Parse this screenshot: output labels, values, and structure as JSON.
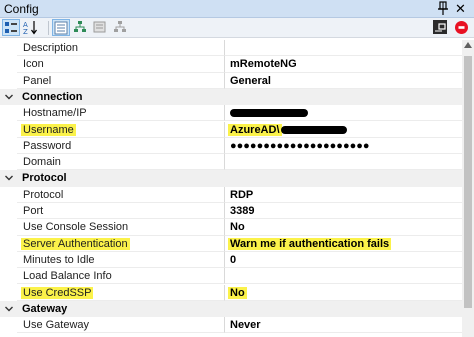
{
  "window": {
    "title": "Config"
  },
  "toolbar": {
    "buttons": [
      {
        "name": "categorized-button",
        "icon": "categorized-icon",
        "active": true
      },
      {
        "name": "alphabetical-button",
        "icon": "sort-az-icon",
        "active": false
      },
      {
        "name": "properties-button",
        "icon": "properties-icon",
        "active": true
      },
      {
        "name": "inheritance-button",
        "icon": "inheritance-icon",
        "active": false
      },
      {
        "name": "default-properties-button",
        "icon": "default-properties-icon",
        "active": false
      },
      {
        "name": "default-inheritance-button",
        "icon": "default-inheritance-icon",
        "active": false
      }
    ],
    "right_icons": [
      "host-status-icon",
      "red-stop-icon"
    ]
  },
  "colors": {
    "highlight": "#fbf24a",
    "titlebar": "#cfe0f3",
    "category_bg": "#f0f0f0",
    "stop_red": "#e81123"
  },
  "rows": [
    {
      "type": "prop",
      "name": "Description",
      "value": ""
    },
    {
      "type": "prop",
      "name": "Icon",
      "value": "mRemoteNG"
    },
    {
      "type": "prop",
      "name": "Panel",
      "value": "General"
    },
    {
      "type": "cat",
      "name": "Connection"
    },
    {
      "type": "prop",
      "name": "Hostname/IP",
      "value": "",
      "redact": true
    },
    {
      "type": "prop",
      "name": "Username",
      "value": "AzureAD\\",
      "redact": true,
      "hl_name": true,
      "hl_value": true
    },
    {
      "type": "prop",
      "name": "Password",
      "value": "●●●●●●●●●●●●●●●●●●●●●"
    },
    {
      "type": "prop",
      "name": "Domain",
      "value": ""
    },
    {
      "type": "cat",
      "name": "Protocol"
    },
    {
      "type": "prop",
      "name": "Protocol",
      "value": "RDP"
    },
    {
      "type": "prop",
      "name": "Port",
      "value": "3389"
    },
    {
      "type": "prop",
      "name": "Use Console Session",
      "value": "No"
    },
    {
      "type": "prop",
      "name": "Server Authentication",
      "value": "Warn me if authentication fails",
      "hl_name": true,
      "hl_value": true
    },
    {
      "type": "prop",
      "name": "Minutes to Idle",
      "value": "0"
    },
    {
      "type": "prop",
      "name": "Load Balance Info",
      "value": ""
    },
    {
      "type": "prop",
      "name": "Use CredSSP",
      "value": "No",
      "hl_name": true,
      "hl_value": true
    },
    {
      "type": "cat",
      "name": "Gateway"
    },
    {
      "type": "prop",
      "name": "Use Gateway",
      "value": "Never"
    }
  ]
}
